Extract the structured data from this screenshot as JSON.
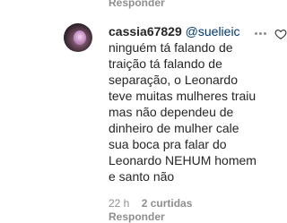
{
  "top_reply": {
    "label": "Responder"
  },
  "comment": {
    "username": "cassia67829",
    "mention": "@suelieic",
    "text": "ninguém tá falando de\ntraição tá falando de\nseparação, o Leonardo\nteve muitas mulheres traiu\nmas não dependeu de\ndinheiro de mulher cale\nsua boca pra falar do\nLeonardo NEHUM homem\ne santo não",
    "time": "22 h",
    "likes": "2 curtidas",
    "reply_label": "Responder"
  },
  "icons": {
    "more": "more-options-icon",
    "like": "heart-icon",
    "avatar": "avatar"
  },
  "colors": {
    "text": "#262626",
    "muted": "#8e8e8e",
    "mention": "#00376b"
  }
}
